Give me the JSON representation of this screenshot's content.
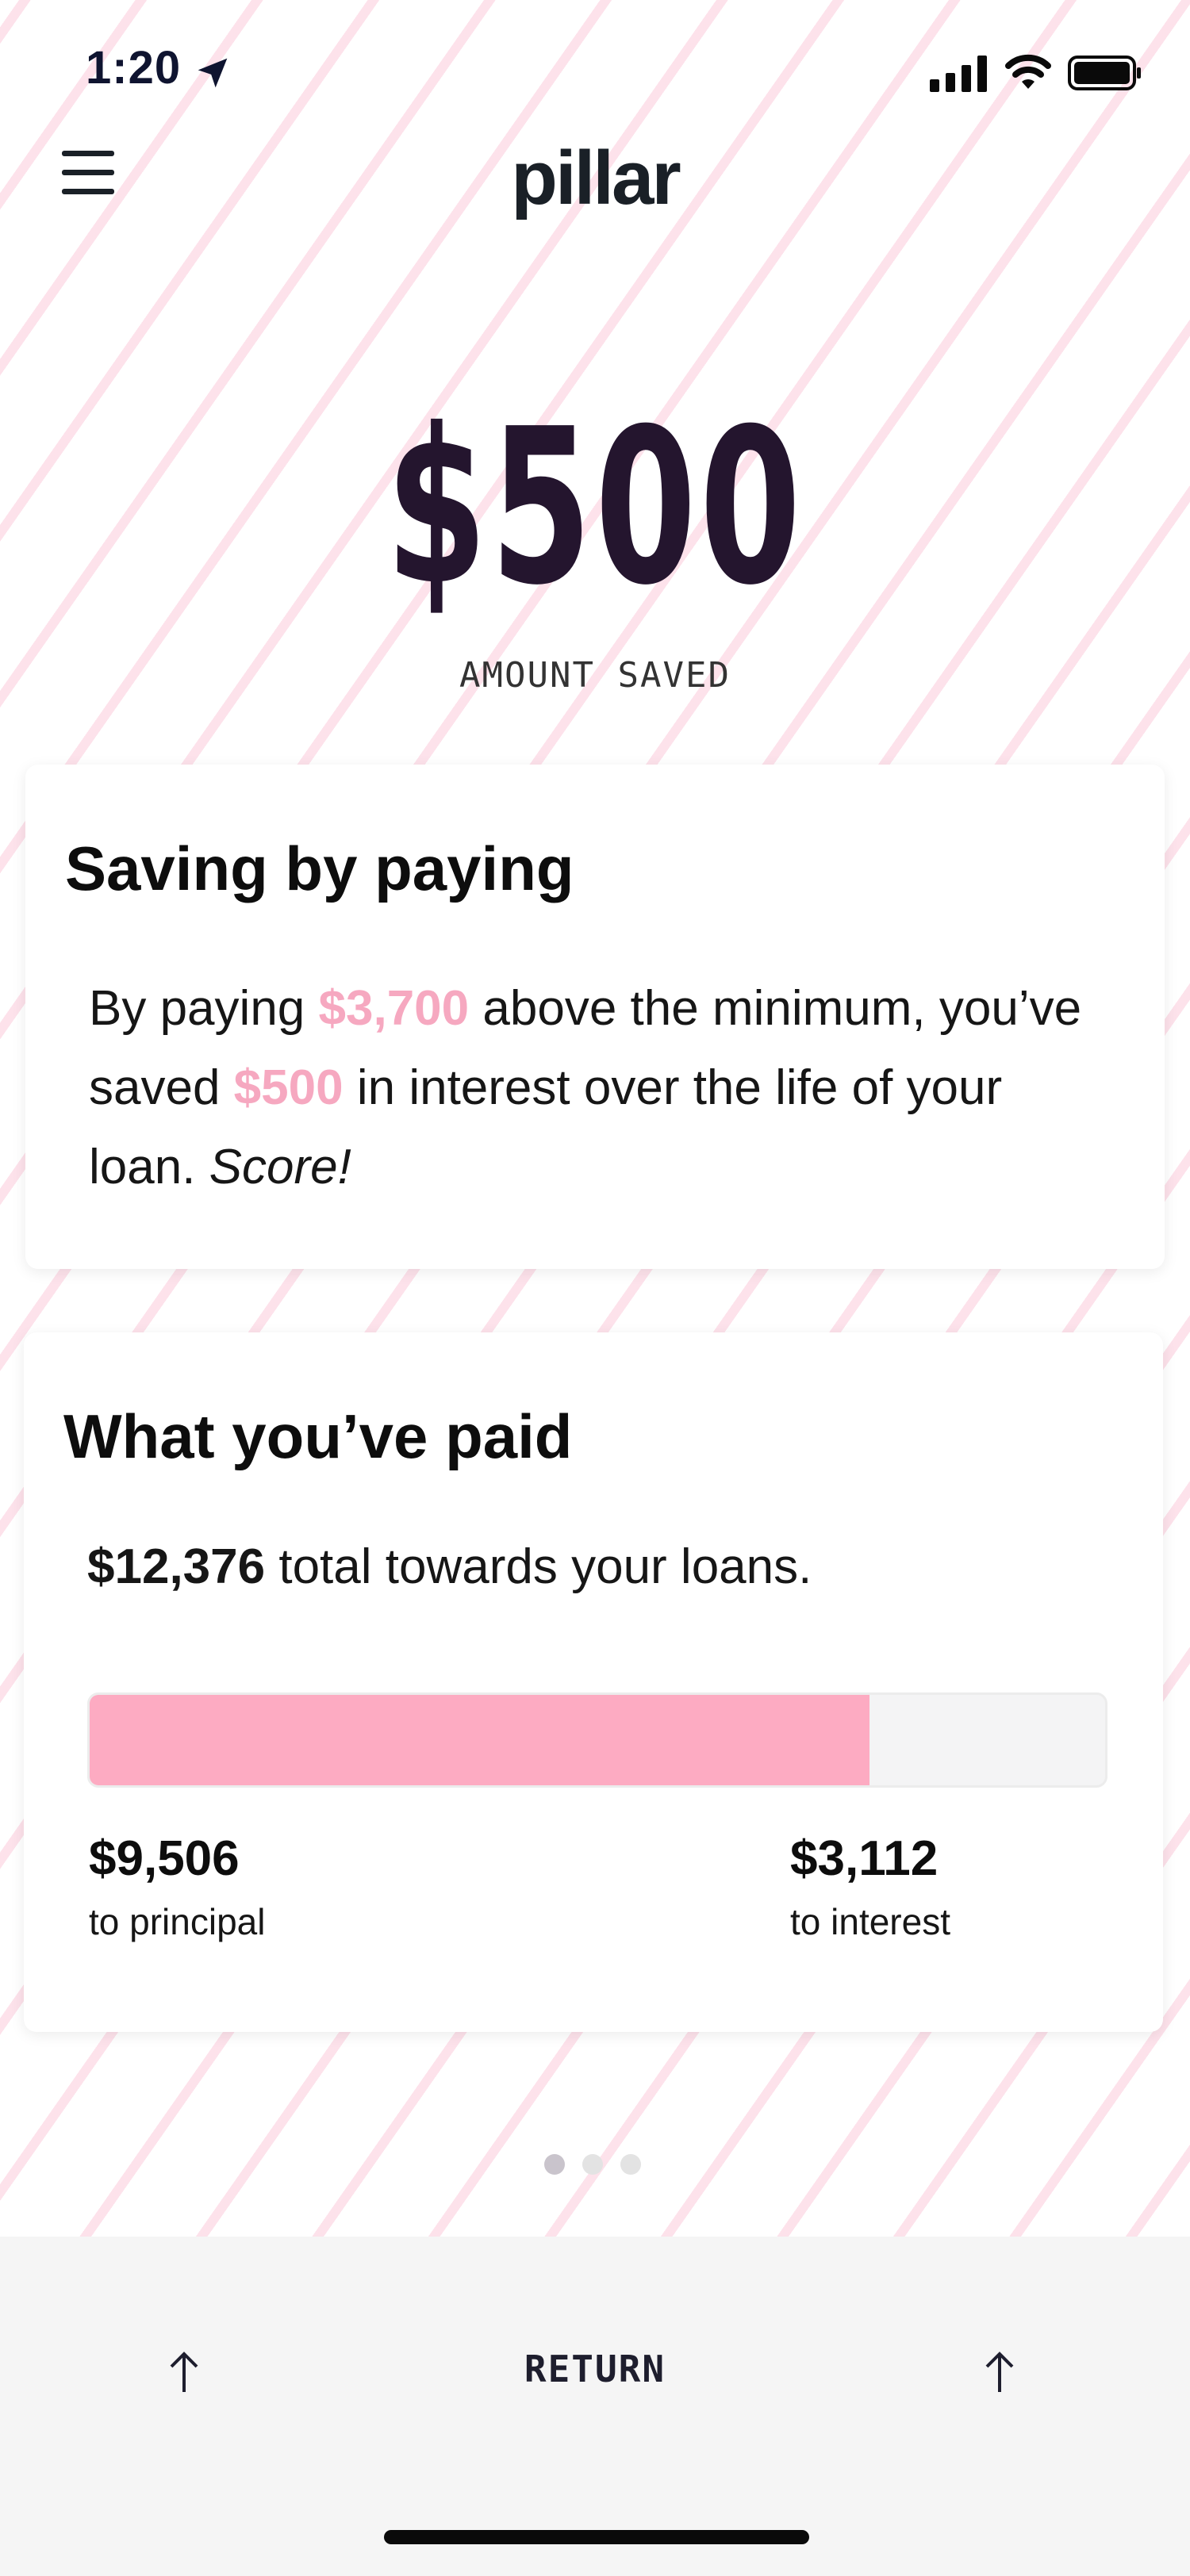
{
  "status_bar": {
    "time": "1:20",
    "icons": [
      "location-arrow-icon",
      "signal-icon",
      "wifi-icon",
      "battery-icon"
    ]
  },
  "header": {
    "logo": "pillar",
    "menu_icon": "hamburger-menu-icon"
  },
  "hero": {
    "amount": "$500",
    "label": "AMOUNT SAVED"
  },
  "saving_card": {
    "title": "Saving by paying",
    "text_1": "By paying ",
    "amount_above": "$3,700",
    "text_2": " above the minimum, you’ve saved ",
    "amount_saved": "$500",
    "text_3": " in interest over the life of your loan. ",
    "text_emphasis": "Score!"
  },
  "paid_card": {
    "title": "What you’ve paid",
    "total": "$12,376",
    "total_suffix": " total towards your loans.",
    "principal_fraction": 0.7681,
    "principal_value": "$9,506",
    "principal_label": "to principal",
    "interest_value": "$3,112",
    "interest_label": "to interest"
  },
  "pagination": {
    "pages": 3,
    "active_index": 0
  },
  "bottom_bar": {
    "return_label": "RETURN",
    "left_arrow_icon": "up-arrow-icon",
    "right_arrow_icon": "up-arrow-icon"
  },
  "colors": {
    "accent_pink": "#fdabc2",
    "dark": "#24152e"
  }
}
